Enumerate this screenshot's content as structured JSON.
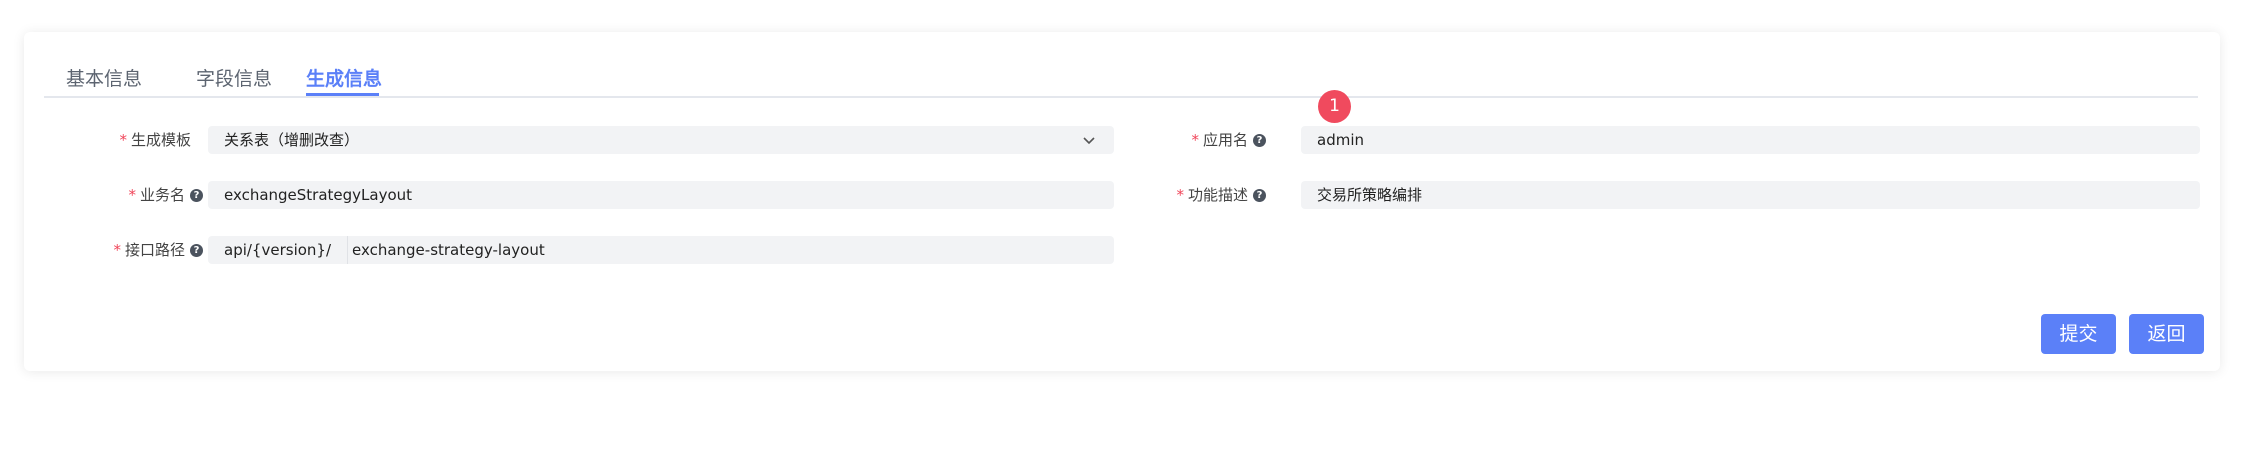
{
  "tabs": [
    {
      "label": "基本信息",
      "active": false
    },
    {
      "label": "字段信息",
      "active": false
    },
    {
      "label": "生成信息",
      "active": true
    }
  ],
  "form": {
    "template": {
      "label": "生成模板",
      "value": "关系表（增删改查）"
    },
    "app_name": {
      "label": "应用名",
      "value": "admin"
    },
    "business_name": {
      "label": "业务名",
      "value": "exchangeStrategyLayout"
    },
    "function_desc": {
      "label": "功能描述",
      "value": "交易所策略编排"
    },
    "api_path": {
      "label": "接口路径",
      "prefix": "api/{version}/",
      "value": "exchange-strategy-layout"
    }
  },
  "buttons": {
    "submit": "提交",
    "back": "返回"
  },
  "badge": "1",
  "colors": {
    "accent": "#5b80f8",
    "required": "#f0465a",
    "badge": "#f04a5e"
  }
}
